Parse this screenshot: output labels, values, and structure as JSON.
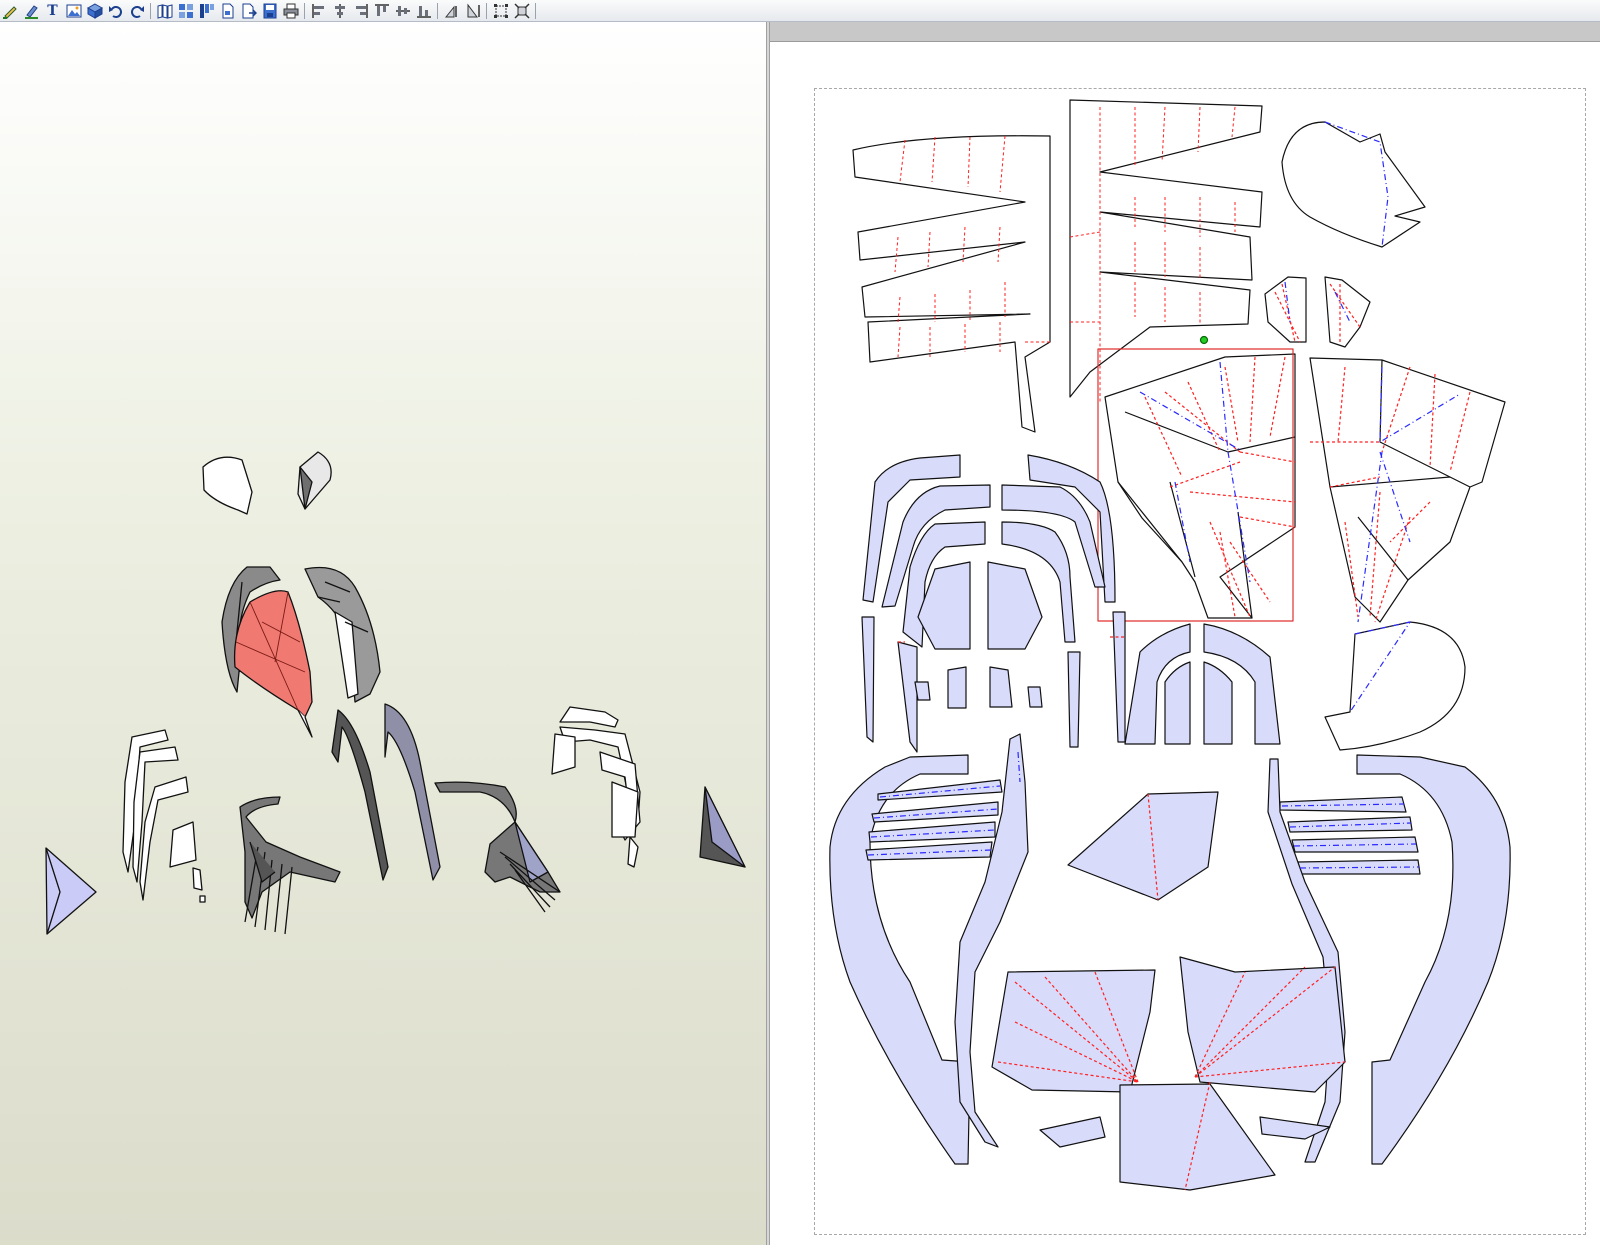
{
  "app": {
    "accent": "#1b3f8f",
    "part_fill": "#d9dbfb",
    "selection_color": "#e03030",
    "mountain_fold_color": "#ff2020",
    "valley_fold_color": "#2a2aff",
    "selected_face_color": "#f07a72"
  },
  "toolbar": {
    "buttons": [
      {
        "name": "pencil-icon"
      },
      {
        "name": "edit-icon"
      },
      {
        "name": "text-tool",
        "label": "T"
      },
      {
        "name": "image-icon"
      },
      {
        "name": "cube-icon"
      },
      {
        "name": "undo-icon"
      },
      {
        "name": "redo-icon"
      },
      {
        "name": "unfold-icon"
      },
      {
        "name": "grid-icon"
      },
      {
        "name": "layout-icon"
      },
      {
        "name": "page-icon"
      },
      {
        "name": "export-icon"
      },
      {
        "name": "save-icon"
      },
      {
        "name": "print-icon"
      },
      {
        "name": "align-left-icon"
      },
      {
        "name": "align-center-icon"
      },
      {
        "name": "align-right-icon"
      },
      {
        "name": "align-top-icon"
      },
      {
        "name": "align-middle-icon"
      },
      {
        "name": "align-bottom-icon"
      },
      {
        "name": "rotate-icon"
      },
      {
        "name": "flip-icon"
      },
      {
        "name": "select-parts-icon"
      },
      {
        "name": "zoom-fit-icon"
      }
    ]
  }
}
